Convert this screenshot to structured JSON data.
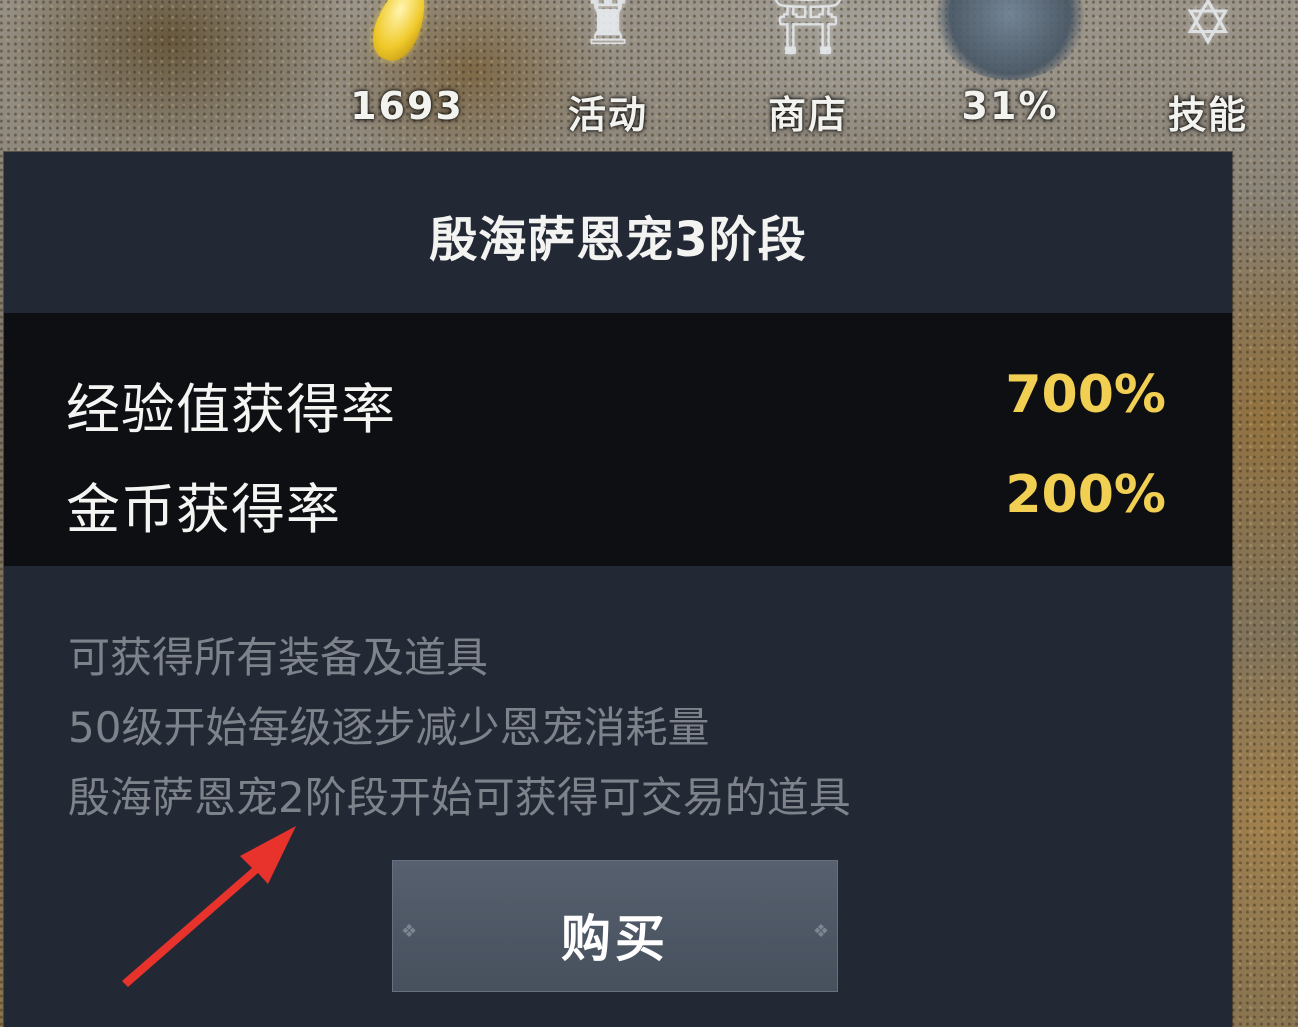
{
  "hud": {
    "items": [
      {
        "icon": "gold-leaf-icon",
        "label": "1693"
      },
      {
        "icon": "activity-chest-icon",
        "label": "活动"
      },
      {
        "icon": "shop-icon",
        "label": "商店"
      },
      {
        "icon": "rune-helmet-icon",
        "label": "31%"
      },
      {
        "icon": "skill-icon",
        "label": "技能"
      }
    ]
  },
  "dialog": {
    "title": "殷海萨恩宠3阶段",
    "stats": [
      {
        "name": "经验值获得率",
        "value": "700%"
      },
      {
        "name": "金币获得率",
        "value": "200%"
      }
    ],
    "description": [
      "可获得所有装备及道具",
      "50级开始每级逐步减少恩宠消耗量",
      "殷海萨恩宠2阶段开始可获得可交易的道具"
    ],
    "buy_button": "购买"
  },
  "colors": {
    "dialog_bg": "#232934",
    "stats_band_bg": "#0d0f13",
    "stat_value": "#f1cf52",
    "desc_text": "#7d828b",
    "annotation_arrow": "#e8322c"
  }
}
